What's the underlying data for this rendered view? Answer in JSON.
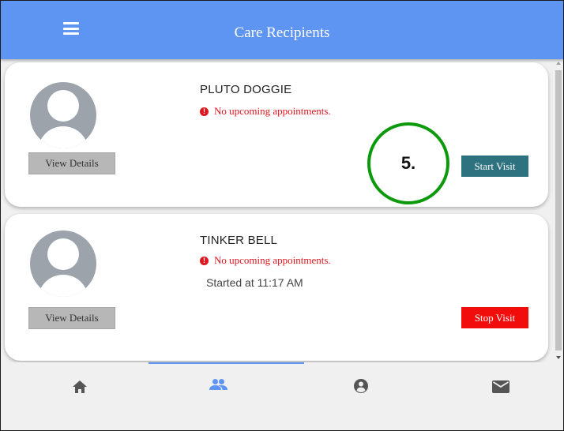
{
  "header": {
    "title": "Care Recipients"
  },
  "recipients": [
    {
      "name": "PLUTO DOGGIE",
      "appointment_status": "No upcoming appointments.",
      "view_label": "View Details",
      "action_label": "Start Visit"
    },
    {
      "name": "TINKER BELL",
      "appointment_status": "No upcoming appointments.",
      "started_text": "Started at 11:17 AM",
      "view_label": "View Details",
      "action_label": "Stop Visit"
    }
  ],
  "step_marker": "5.",
  "bottom_nav": {
    "items": [
      "home-icon",
      "people-icon",
      "account-icon",
      "mail-icon"
    ],
    "active": "people-icon"
  },
  "colors": {
    "header_bg": "#5f95f2",
    "start_button": "#2e7280",
    "stop_button": "#f20d0d",
    "error_text": "#e0161f",
    "step_circle": "#0c9a0c",
    "nav_icon": "#555555",
    "nav_icon_active": "#5f95f2"
  }
}
